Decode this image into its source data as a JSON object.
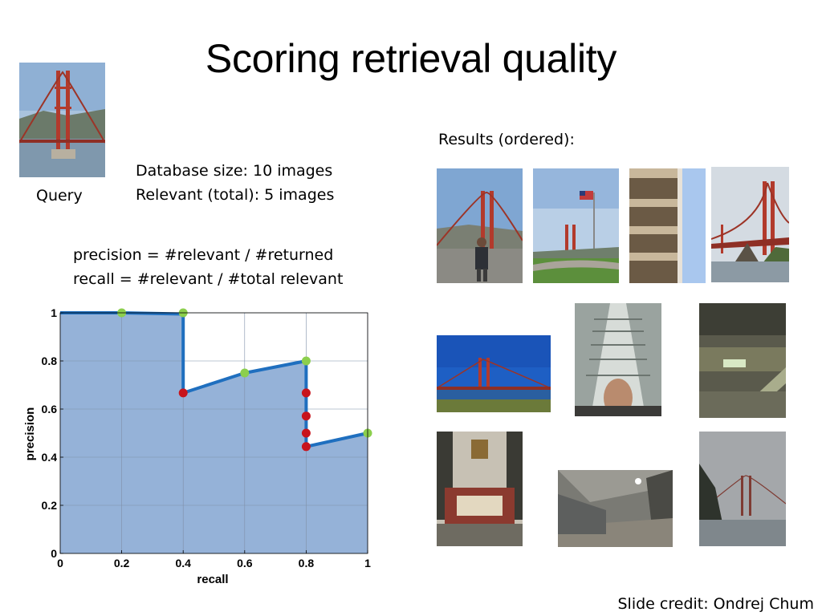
{
  "title": "Scoring retrieval quality",
  "query": {
    "label": "Query"
  },
  "database": {
    "size_line": "Database size: 10 images",
    "relevant_line": "Relevant (total): 5 images"
  },
  "formulas": {
    "precision": "precision = #relevant / #returned",
    "recall": "recall = #relevant / #total relevant"
  },
  "results": {
    "heading": "Results (ordered):",
    "images": [
      {
        "rank": 1,
        "subject": "golden gate bridge with person",
        "relevant": true
      },
      {
        "rank": 2,
        "subject": "golden gate bridge with flag",
        "relevant": true
      },
      {
        "rank": 3,
        "subject": "building balconies",
        "relevant": false
      },
      {
        "rank": 4,
        "subject": "golden gate bridge from shore",
        "relevant": true
      },
      {
        "rank": 5,
        "subject": "golden gate bridge wide view",
        "relevant": true
      },
      {
        "rank": 6,
        "subject": "tower with face",
        "relevant": false
      },
      {
        "rank": 7,
        "subject": "mall interior escalators",
        "relevant": false
      },
      {
        "rank": 8,
        "subject": "building facade",
        "relevant": false
      },
      {
        "rank": 9,
        "subject": "tall building at night",
        "relevant": false
      },
      {
        "rank": 10,
        "subject": "golden gate bridge in fog",
        "relevant": true
      }
    ]
  },
  "credit": "Slide credit: Ondrej Chum",
  "colors": {
    "area_fill": "#95b2d8",
    "curve": "#1f6fbf",
    "relevant_point": "#8ccf4d",
    "irrelevant_point": "#c8141c",
    "grid": "#7f8fa8"
  },
  "chart_data": {
    "type": "area",
    "xlabel": "recall",
    "ylabel": "precision",
    "xlim": [
      0,
      1
    ],
    "ylim": [
      0,
      1
    ],
    "xticks": [
      "0",
      "0.2",
      "0.4",
      "0.6",
      "0.8",
      "1"
    ],
    "yticks": [
      "0",
      "0.2",
      "0.4",
      "0.6",
      "0.8",
      "1"
    ],
    "grid": true,
    "series": [
      {
        "curve": [
          {
            "x": 0,
            "y": 1
          },
          {
            "x": 0.2,
            "y": 1
          },
          {
            "x": 0.4,
            "y": 0.995
          },
          {
            "x": 0.4,
            "y": 0.667
          },
          {
            "x": 0.6,
            "y": 0.75
          },
          {
            "x": 0.8,
            "y": 0.8
          },
          {
            "x": 0.8,
            "y": 0.444
          },
          {
            "x": 1,
            "y": 0.5
          }
        ],
        "points": [
          {
            "x": 0.2,
            "y": 1.0,
            "relevant": true
          },
          {
            "x": 0.4,
            "y": 1.0,
            "relevant": true
          },
          {
            "x": 0.4,
            "y": 0.667,
            "relevant": false
          },
          {
            "x": 0.6,
            "y": 0.75,
            "relevant": true
          },
          {
            "x": 0.8,
            "y": 0.8,
            "relevant": true
          },
          {
            "x": 0.8,
            "y": 0.667,
            "relevant": false
          },
          {
            "x": 0.8,
            "y": 0.571,
            "relevant": false
          },
          {
            "x": 0.8,
            "y": 0.5,
            "relevant": false
          },
          {
            "x": 0.8,
            "y": 0.444,
            "relevant": false
          },
          {
            "x": 1.0,
            "y": 0.5,
            "relevant": true
          }
        ]
      }
    ]
  }
}
